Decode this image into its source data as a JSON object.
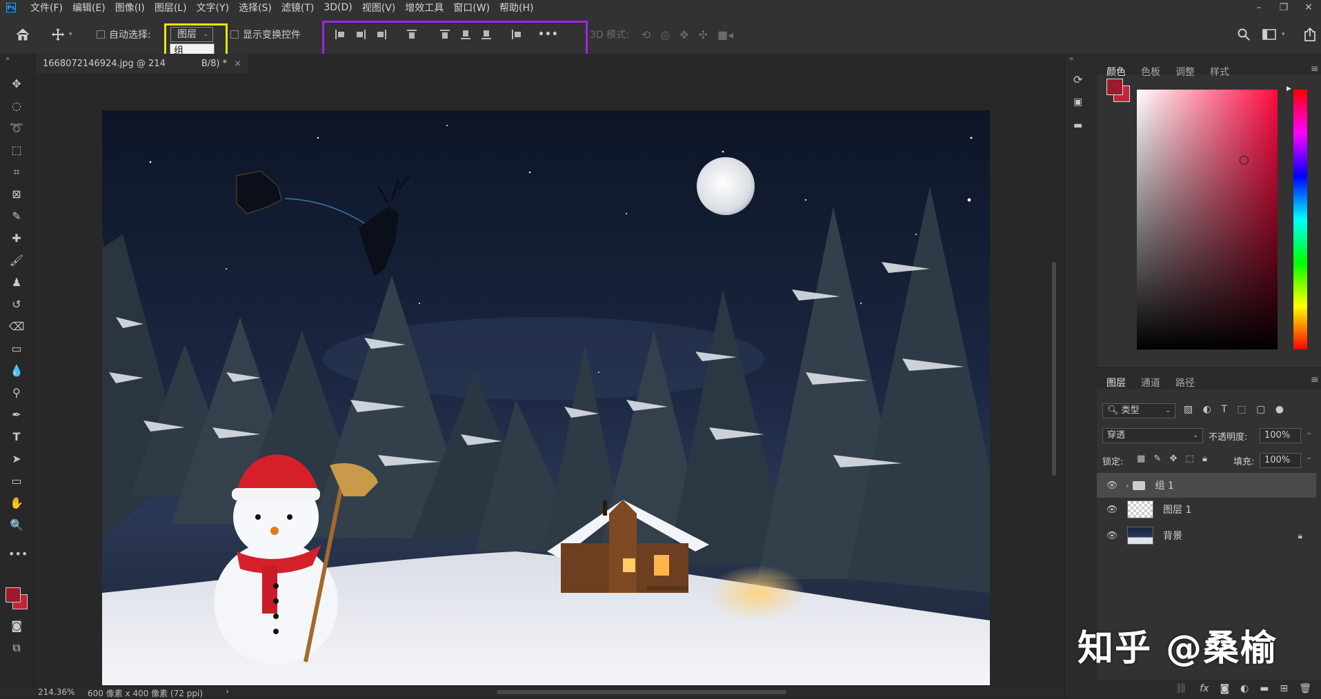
{
  "app": {
    "logo_text": "Ps"
  },
  "menu": [
    "文件(F)",
    "编辑(E)",
    "图像(I)",
    "图层(L)",
    "文字(Y)",
    "选择(S)",
    "滤镜(T)",
    "3D(D)",
    "视图(V)",
    "增效工具",
    "窗口(W)",
    "帮助(H)"
  ],
  "window_controls": {
    "minimize": "–",
    "restore": "❐",
    "close": "✕"
  },
  "options": {
    "auto_select_label": "自动选择:",
    "auto_select_checked": false,
    "auto_select_value": "图层",
    "dropdown_options": [
      "组",
      "图层"
    ],
    "dropdown_selected": "图层",
    "show_transform_label": "显示变换控件",
    "show_transform_checked": false,
    "more_label": "•••",
    "mode_3d_label": "3D 模式:"
  },
  "document": {
    "tab_title": "1668072146924.jpg @ 214",
    "tab_suffix": "B/8) *",
    "close_glyph": "×"
  },
  "status": {
    "zoom": "214.36%",
    "doc_info": "600 像素 x 400 像素 (72 ppi)"
  },
  "color_panel": {
    "tabs": [
      "颜色",
      "色板",
      "调整",
      "样式"
    ],
    "active_tab": "颜色",
    "foreground": "#9a1b2b",
    "background": "#c3243a",
    "hue_color": "#ff0a40"
  },
  "layers_panel": {
    "tabs": [
      "图层",
      "通道",
      "路径"
    ],
    "active_tab": "图层",
    "filter_label": "类型",
    "blend_mode": "穿透",
    "opacity_label": "不透明度:",
    "opacity": "100%",
    "lock_label": "锁定:",
    "fill_label": "填充:",
    "fill": "100%",
    "layers": [
      {
        "name": "组 1",
        "type": "group",
        "active": true,
        "locked": false
      },
      {
        "name": "图层 1",
        "type": "layer",
        "active": false,
        "locked": false
      },
      {
        "name": "背景",
        "type": "background",
        "active": false,
        "locked": true
      }
    ],
    "footer_icons": [
      "link-icon",
      "fx-icon",
      "mask-icon",
      "adjustment-icon",
      "folder-icon",
      "new-layer-icon",
      "trash-icon"
    ],
    "fx_label": "fx"
  },
  "watermark": "知乎 @桑榆"
}
